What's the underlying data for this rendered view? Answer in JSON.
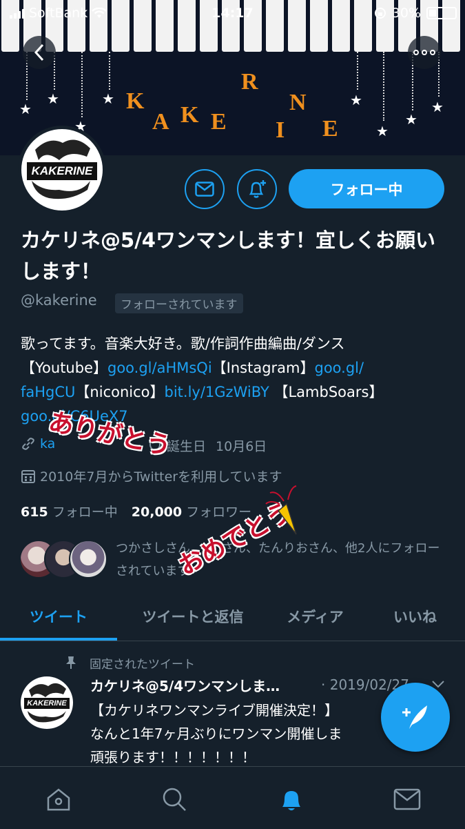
{
  "status_bar": {
    "carrier": "SoftBank",
    "time": "14:17",
    "battery": "30%"
  },
  "banner": {
    "letters": [
      "K",
      "A",
      "K",
      "E",
      "R",
      "I",
      "N",
      "E"
    ]
  },
  "avatar": {
    "logo_text": "KAKERINE"
  },
  "profile": {
    "name": "カケリネ@5/4ワンマンします！宜しくお願いします！",
    "handle": "@kakerine",
    "followed_badge": "フォローされています",
    "follow_button": "フォロー中",
    "bio_plain_1": "歌ってます。音楽大好き。歌/作詞作曲編曲/ダンス",
    "bio_seg_2": "【Youtube】",
    "bio_link_1": "goo.gl/aHMsQi",
    "bio_seg_3": "【Instagram】",
    "bio_link_2a": "goo.gl/",
    "bio_link_2b": "faHgCU",
    "bio_seg_4": "【niconico】",
    "bio_link_3": "bit.ly/1GzWiBY",
    "bio_seg_5": "【LambSoars】",
    "bio_link_4": "goo.gl/C6UeX7",
    "website": "ka",
    "birthday_label": "誕生日",
    "birthday": "10月6日",
    "joined": "2010年7月からTwitterを利用しています",
    "following_count": "615",
    "following_label": "フォロー中",
    "followers_count": "20,000",
    "followers_label": "フォロワー",
    "followed_by": "つかさしさん、　　さん、たんりおさん、他2人にフォローされています"
  },
  "stickers": {
    "top": "ありがとう",
    "bottom": "おめでとう"
  },
  "tabs": [
    "ツイート",
    "ツイートと返信",
    "メディア",
    "いいね"
  ],
  "pinned_tweet": {
    "label": "固定されたツイート",
    "name": "カケリネ@5/4ワンマンしま…",
    "date": "· 2019/02/27",
    "line1": "【カケリネワンマンライブ開催決定！】",
    "line2": "なんと1年7ヶ月ぶりにワンマン開催しま",
    "line3": "頑張ります！！！！！！！"
  },
  "bottom_nav": [
    "home-icon",
    "search-icon",
    "notifications-icon",
    "messages-icon"
  ],
  "colors": {
    "accent": "#1da1f2",
    "background": "#15202b",
    "muted": "#8899a6",
    "banner_letters": "#f0901e"
  }
}
